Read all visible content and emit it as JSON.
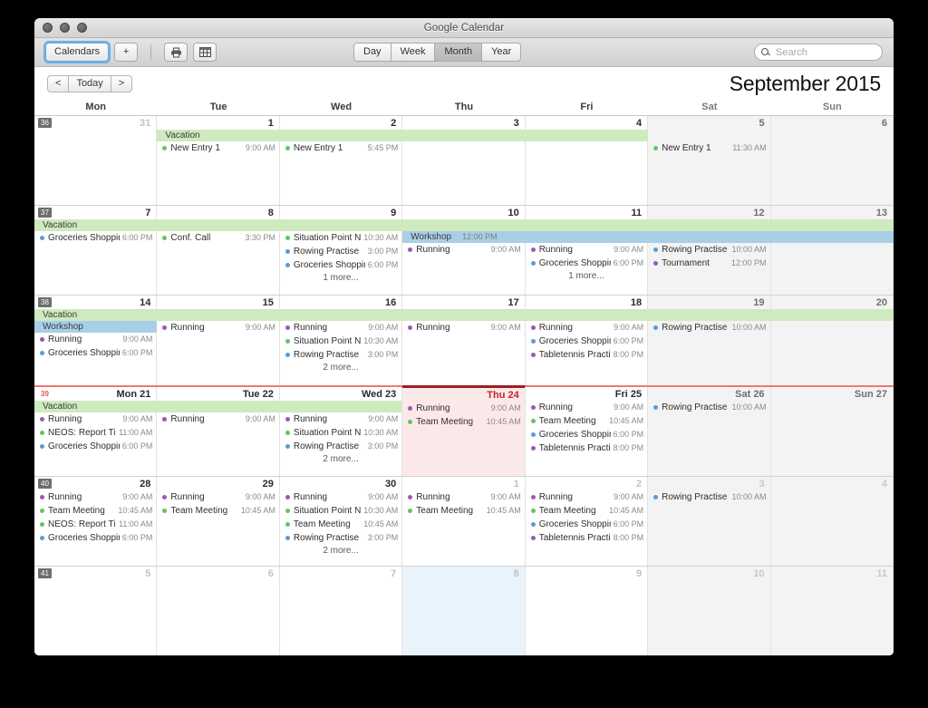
{
  "window": {
    "title": "Google Calendar"
  },
  "toolbar": {
    "calendars_label": "Calendars",
    "add_label": "+",
    "print_icon": "printer-icon",
    "table_icon": "grid-icon",
    "views": [
      "Day",
      "Week",
      "Month",
      "Year"
    ],
    "active_view": "Month",
    "search_placeholder": "Search",
    "search_value": ""
  },
  "nav": {
    "prev_label": "<",
    "today_label": "Today",
    "next_label": ">",
    "month_title": "September 2015"
  },
  "day_headers": [
    "Mon",
    "Tue",
    "Wed",
    "Thu",
    "Fri",
    "Sat",
    "Sun"
  ],
  "colors": {
    "running": "#9b59b6",
    "meeting_green": "#63c464",
    "shopping_blue": "#5b9bd5",
    "vacation_bar": "#cfeabe",
    "workshop_bar": "#a8cfe8",
    "today_accent": "#9b1f22",
    "week_accent": "#f2776b"
  },
  "weeks": [
    {
      "number": "36",
      "today_week": false,
      "bars": [
        {
          "label": "Vacation",
          "time": "",
          "color": "green",
          "start": 1,
          "span": 4,
          "row": 0
        }
      ],
      "days": [
        {
          "num": "31",
          "other": true,
          "weekend": false,
          "events": []
        },
        {
          "num": "1",
          "other": false,
          "weekend": false,
          "events": [
            {
              "name": "New Entry 1",
              "time": "9:00 AM",
              "color": "meeting_green"
            }
          ],
          "offset": 1
        },
        {
          "num": "2",
          "other": false,
          "weekend": false,
          "events": [
            {
              "name": "New Entry 1",
              "time": "5:45 PM",
              "color": "meeting_green"
            }
          ],
          "offset": 1
        },
        {
          "num": "3",
          "other": false,
          "weekend": false,
          "events": [],
          "offset": 1
        },
        {
          "num": "4",
          "other": false,
          "weekend": false,
          "events": [],
          "offset": 1
        },
        {
          "num": "5",
          "other": false,
          "weekend": true,
          "events": [
            {
              "name": "New Entry 1",
              "time": "11:30 AM",
              "color": "meeting_green"
            }
          ],
          "offset": 1
        },
        {
          "num": "6",
          "other": false,
          "weekend": true,
          "events": []
        }
      ]
    },
    {
      "number": "37",
      "today_week": false,
      "bars": [
        {
          "label": "Vacation",
          "time": "",
          "color": "green",
          "start": 0,
          "span": 7,
          "row": 0
        },
        {
          "label": "Workshop",
          "time": "12:00 PM",
          "color": "blue",
          "start": 3,
          "span": 4,
          "row": 1
        }
      ],
      "days": [
        {
          "num": "7",
          "other": false,
          "weekend": false,
          "offset": 1,
          "events": [
            {
              "name": "Groceries Shopping",
              "time": "6:00 PM",
              "color": "shopping_blue"
            }
          ]
        },
        {
          "num": "8",
          "other": false,
          "weekend": false,
          "offset": 1,
          "events": [
            {
              "name": "Conf. Call",
              "time": "3:30 PM",
              "color": "meeting_green"
            }
          ]
        },
        {
          "num": "9",
          "other": false,
          "weekend": false,
          "offset": 1,
          "events": [
            {
              "name": "Situation Point N...",
              "time": "10:30 AM",
              "color": "meeting_green"
            },
            {
              "name": "Rowing Practise",
              "time": "3:00 PM",
              "color": "shopping_blue"
            },
            {
              "name": "Groceries Shopping",
              "time": "6:00 PM",
              "color": "shopping_blue"
            }
          ],
          "more": "1 more..."
        },
        {
          "num": "10",
          "other": false,
          "weekend": false,
          "offset": 2,
          "events": [
            {
              "name": "Running",
              "time": "9:00 AM",
              "color": "running"
            }
          ]
        },
        {
          "num": "11",
          "other": false,
          "weekend": false,
          "offset": 2,
          "events": [
            {
              "name": "Running",
              "time": "9:00 AM",
              "color": "running"
            },
            {
              "name": "Groceries Shopping",
              "time": "6:00 PM",
              "color": "shopping_blue"
            }
          ],
          "more": "1 more..."
        },
        {
          "num": "12",
          "other": false,
          "weekend": true,
          "offset": 2,
          "events": [
            {
              "name": "Rowing Practise",
              "time": "10:00 AM",
              "color": "shopping_blue"
            },
            {
              "name": "Tournament",
              "time": "12:00 PM",
              "color": "running"
            }
          ]
        },
        {
          "num": "13",
          "other": false,
          "weekend": true,
          "offset": 2,
          "events": []
        }
      ]
    },
    {
      "number": "38",
      "today_week": false,
      "bars": [
        {
          "label": "Vacation",
          "time": "",
          "color": "green",
          "start": 0,
          "span": 7,
          "row": 0
        },
        {
          "label": "Workshop",
          "time": "",
          "color": "blue",
          "start": 0,
          "span": 1,
          "row": 1
        }
      ],
      "days": [
        {
          "num": "14",
          "other": false,
          "weekend": false,
          "offset": 2,
          "events": [
            {
              "name": "Running",
              "time": "9:00 AM",
              "color": "running"
            },
            {
              "name": "Groceries Shopping",
              "time": "6:00 PM",
              "color": "shopping_blue"
            }
          ]
        },
        {
          "num": "15",
          "other": false,
          "weekend": false,
          "offset": 1,
          "events": [
            {
              "name": "Running",
              "time": "9:00 AM",
              "color": "running"
            }
          ]
        },
        {
          "num": "16",
          "other": false,
          "weekend": false,
          "offset": 1,
          "events": [
            {
              "name": "Running",
              "time": "9:00 AM",
              "color": "running"
            },
            {
              "name": "Situation Point N...",
              "time": "10:30 AM",
              "color": "meeting_green"
            },
            {
              "name": "Rowing Practise",
              "time": "3:00 PM",
              "color": "shopping_blue"
            }
          ],
          "more": "2 more..."
        },
        {
          "num": "17",
          "other": false,
          "weekend": false,
          "offset": 1,
          "events": [
            {
              "name": "Running",
              "time": "9:00 AM",
              "color": "running"
            }
          ]
        },
        {
          "num": "18",
          "other": false,
          "weekend": false,
          "offset": 1,
          "events": [
            {
              "name": "Running",
              "time": "9:00 AM",
              "color": "running"
            },
            {
              "name": "Groceries Shopping",
              "time": "6:00 PM",
              "color": "shopping_blue"
            },
            {
              "name": "Tabletennis Practi...",
              "time": "8:00 PM",
              "color": "running"
            }
          ]
        },
        {
          "num": "19",
          "other": false,
          "weekend": true,
          "offset": 1,
          "events": [
            {
              "name": "Rowing Practise",
              "time": "10:00 AM",
              "color": "shopping_blue"
            }
          ]
        },
        {
          "num": "20",
          "other": false,
          "weekend": true,
          "offset": 1,
          "events": []
        }
      ]
    },
    {
      "number": "39",
      "today_week": true,
      "bars": [
        {
          "label": "Vacation",
          "time": "",
          "color": "green",
          "start": 0,
          "span": 3,
          "row": 0
        }
      ],
      "days": [
        {
          "num": "Mon 21",
          "other": false,
          "weekend": false,
          "offset": 1,
          "events": [
            {
              "name": "Running",
              "time": "9:00 AM",
              "color": "running"
            },
            {
              "name": "NEOS: Report Ti...",
              "time": "11:00 AM",
              "color": "meeting_green"
            },
            {
              "name": "Groceries Shopping",
              "time": "6:00 PM",
              "color": "shopping_blue"
            }
          ]
        },
        {
          "num": "Tue 22",
          "other": false,
          "weekend": false,
          "offset": 1,
          "events": [
            {
              "name": "Running",
              "time": "9:00 AM",
              "color": "running"
            }
          ]
        },
        {
          "num": "Wed 23",
          "other": false,
          "weekend": false,
          "offset": 1,
          "events": [
            {
              "name": "Running",
              "time": "9:00 AM",
              "color": "running"
            },
            {
              "name": "Situation Point N...",
              "time": "10:30 AM",
              "color": "meeting_green"
            },
            {
              "name": "Rowing Practise",
              "time": "3:00 PM",
              "color": "shopping_blue"
            }
          ],
          "more": "2 more..."
        },
        {
          "num": "Thu 24",
          "other": false,
          "weekend": false,
          "today": true,
          "offset": 0,
          "events": [
            {
              "name": "Running",
              "time": "9:00 AM",
              "color": "running"
            },
            {
              "name": "Team Meeting",
              "time": "10:45 AM",
              "color": "meeting_green"
            }
          ]
        },
        {
          "num": "Fri 25",
          "other": false,
          "weekend": false,
          "offset": 0,
          "events": [
            {
              "name": "Running",
              "time": "9:00 AM",
              "color": "running"
            },
            {
              "name": "Team Meeting",
              "time": "10:45 AM",
              "color": "meeting_green"
            },
            {
              "name": "Groceries Shopping",
              "time": "6:00 PM",
              "color": "shopping_blue"
            },
            {
              "name": "Tabletennis Practi...",
              "time": "8:00 PM",
              "color": "running"
            }
          ]
        },
        {
          "num": "Sat 26",
          "other": false,
          "weekend": true,
          "offset": 0,
          "events": [
            {
              "name": "Rowing Practise",
              "time": "10:00 AM",
              "color": "shopping_blue"
            }
          ]
        },
        {
          "num": "Sun 27",
          "other": false,
          "weekend": true,
          "offset": 0,
          "events": []
        }
      ]
    },
    {
      "number": "40",
      "today_week": false,
      "bars": [],
      "days": [
        {
          "num": "28",
          "other": false,
          "weekend": false,
          "offset": 0,
          "events": [
            {
              "name": "Running",
              "time": "9:00 AM",
              "color": "running"
            },
            {
              "name": "Team Meeting",
              "time": "10:45 AM",
              "color": "meeting_green"
            },
            {
              "name": "NEOS: Report Ti...",
              "time": "11:00 AM",
              "color": "meeting_green"
            },
            {
              "name": "Groceries Shopping",
              "time": "6:00 PM",
              "color": "shopping_blue"
            }
          ]
        },
        {
          "num": "29",
          "other": false,
          "weekend": false,
          "offset": 0,
          "events": [
            {
              "name": "Running",
              "time": "9:00 AM",
              "color": "running"
            },
            {
              "name": "Team Meeting",
              "time": "10:45 AM",
              "color": "meeting_green"
            }
          ]
        },
        {
          "num": "30",
          "other": false,
          "weekend": false,
          "offset": 0,
          "events": [
            {
              "name": "Running",
              "time": "9:00 AM",
              "color": "running"
            },
            {
              "name": "Situation Point N...",
              "time": "10:30 AM",
              "color": "meeting_green"
            },
            {
              "name": "Team Meeting",
              "time": "10:45 AM",
              "color": "meeting_green"
            },
            {
              "name": "Rowing Practise",
              "time": "3:00 PM",
              "color": "shopping_blue"
            }
          ],
          "more": "2 more..."
        },
        {
          "num": "1",
          "other": true,
          "weekend": false,
          "offset": 0,
          "events": [
            {
              "name": "Running",
              "time": "9:00 AM",
              "color": "running"
            },
            {
              "name": "Team Meeting",
              "time": "10:45 AM",
              "color": "meeting_green"
            }
          ]
        },
        {
          "num": "2",
          "other": true,
          "weekend": false,
          "offset": 0,
          "events": [
            {
              "name": "Running",
              "time": "9:00 AM",
              "color": "running"
            },
            {
              "name": "Team Meeting",
              "time": "10:45 AM",
              "color": "meeting_green"
            },
            {
              "name": "Groceries Shopping",
              "time": "6:00 PM",
              "color": "shopping_blue"
            },
            {
              "name": "Tabletennis Practi...",
              "time": "8:00 PM",
              "color": "running"
            }
          ]
        },
        {
          "num": "3",
          "other": true,
          "weekend": true,
          "offset": 0,
          "events": [
            {
              "name": "Rowing Practise",
              "time": "10:00 AM",
              "color": "shopping_blue"
            }
          ]
        },
        {
          "num": "4",
          "other": true,
          "weekend": true,
          "offset": 0,
          "events": []
        }
      ]
    },
    {
      "number": "41",
      "today_week": false,
      "bars": [],
      "days": [
        {
          "num": "5",
          "other": true,
          "weekend": false,
          "events": []
        },
        {
          "num": "6",
          "other": true,
          "weekend": false,
          "events": []
        },
        {
          "num": "7",
          "other": true,
          "weekend": false,
          "events": []
        },
        {
          "num": "8",
          "other": true,
          "weekend": false,
          "selected": true,
          "events": []
        },
        {
          "num": "9",
          "other": true,
          "weekend": false,
          "events": []
        },
        {
          "num": "10",
          "other": true,
          "weekend": true,
          "events": []
        },
        {
          "num": "11",
          "other": true,
          "weekend": true,
          "events": []
        }
      ]
    }
  ]
}
